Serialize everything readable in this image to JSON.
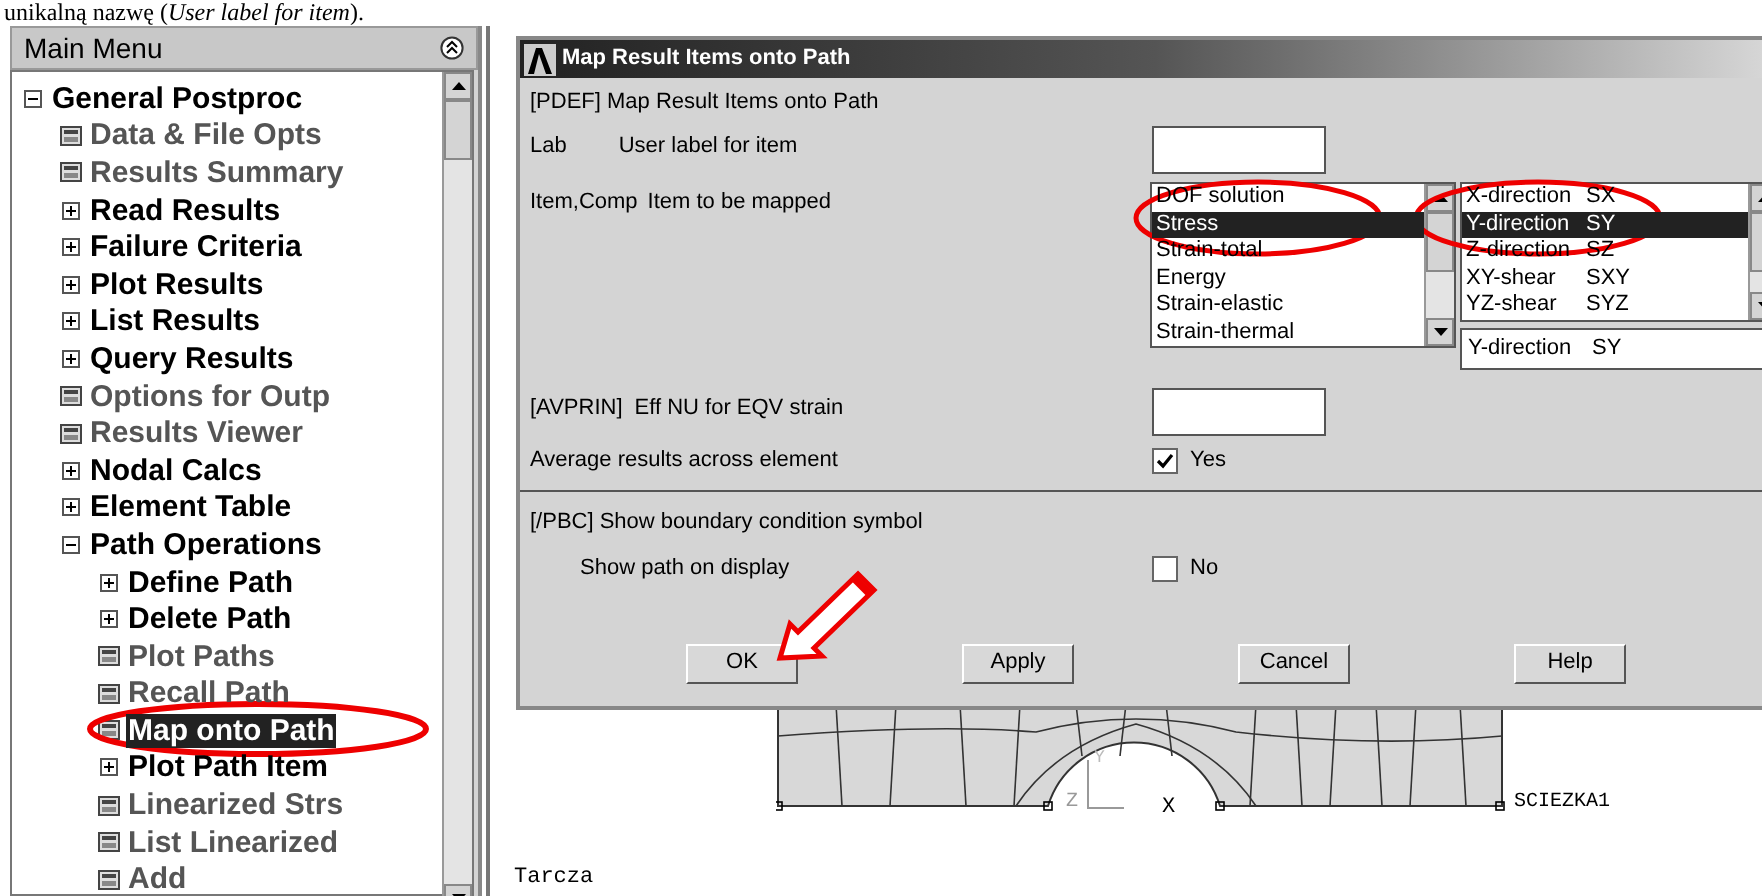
{
  "caption": "unikalną nazwę (*User label for item*).",
  "main_menu": {
    "title": "Main Menu",
    "tree": [
      {
        "label": "General Postproc",
        "kind": "folder",
        "expanded": true,
        "disabled": false,
        "selected": false,
        "children": [
          {
            "label": "Data & File Opts",
            "kind": "command",
            "disabled": true,
            "selected": false
          },
          {
            "label": "Results Summary",
            "kind": "command",
            "disabled": true,
            "selected": false
          },
          {
            "label": "Read Results",
            "kind": "folder",
            "expanded": false,
            "disabled": false,
            "selected": false
          },
          {
            "label": "Failure Criteria",
            "kind": "folder",
            "expanded": false,
            "disabled": false,
            "selected": false
          },
          {
            "label": "Plot Results",
            "kind": "folder",
            "expanded": false,
            "disabled": false,
            "selected": false
          },
          {
            "label": "List Results",
            "kind": "folder",
            "expanded": false,
            "disabled": false,
            "selected": false
          },
          {
            "label": "Query Results",
            "kind": "folder",
            "expanded": false,
            "disabled": false,
            "selected": false
          },
          {
            "label": "Options for Outp",
            "kind": "command",
            "disabled": true,
            "selected": false
          },
          {
            "label": "Results Viewer",
            "kind": "command",
            "disabled": true,
            "selected": false
          },
          {
            "label": "Nodal Calcs",
            "kind": "folder",
            "expanded": false,
            "disabled": false,
            "selected": false
          },
          {
            "label": "Element Table",
            "kind": "folder",
            "expanded": false,
            "disabled": false,
            "selected": false
          },
          {
            "label": "Path Operations",
            "kind": "folder",
            "expanded": true,
            "disabled": false,
            "selected": false,
            "children": [
              {
                "label": "Define Path",
                "kind": "folder",
                "expanded": false,
                "disabled": false,
                "selected": false
              },
              {
                "label": "Delete Path",
                "kind": "folder",
                "expanded": false,
                "disabled": false,
                "selected": false
              },
              {
                "label": "Plot Paths",
                "kind": "command",
                "disabled": true,
                "selected": false
              },
              {
                "label": "Recall Path",
                "kind": "command",
                "disabled": true,
                "selected": false
              },
              {
                "label": "Map onto Path",
                "kind": "command",
                "disabled": false,
                "selected": true
              },
              {
                "label": "Plot Path Item",
                "kind": "folder",
                "expanded": false,
                "disabled": false,
                "selected": false
              },
              {
                "label": "Linearized Strs",
                "kind": "command",
                "disabled": true,
                "selected": false
              },
              {
                "label": "List Linearized",
                "kind": "command",
                "disabled": true,
                "selected": false
              },
              {
                "label": "Add",
                "kind": "command",
                "disabled": true,
                "selected": false
              }
            ]
          }
        ]
      }
    ]
  },
  "dialog": {
    "title": "Map Result Items onto Path",
    "heading": "[PDEF]  Map Result Items onto Path",
    "lab": {
      "label": "Lab",
      "description": "User label for item"
    },
    "item_comp": {
      "label": "Item,Comp",
      "description": "Item to be mapped",
      "items": [
        {
          "label": "DOF solution",
          "selected": false
        },
        {
          "label": "Stress",
          "selected": true
        },
        {
          "label": "Strain-total",
          "selected": false
        },
        {
          "label": "Energy",
          "selected": false
        },
        {
          "label": "Strain-elastic",
          "selected": false
        },
        {
          "label": "Strain-thermal",
          "selected": false
        }
      ],
      "components": [
        {
          "name": "X-direction",
          "code": "SX",
          "selected": false
        },
        {
          "name": "Y-direction",
          "code": "SY",
          "selected": true
        },
        {
          "name": "Z-direction",
          "code": "SZ",
          "selected": false
        },
        {
          "name": "XY-shear",
          "code": "SXY",
          "selected": false
        },
        {
          "name": "YZ-shear",
          "code": "SYZ",
          "selected": false
        }
      ],
      "component_value": {
        "name": "Y-direction",
        "code": "SY"
      }
    },
    "avprin": {
      "label": "[AVPRIN]",
      "description": "Eff NU for EQV strain"
    },
    "average": {
      "label": "Average results across element",
      "checked": true,
      "value_label": "Yes"
    },
    "pbc": {
      "heading": "[/PBC]  Show boundary condition symbol",
      "label": "Show path on display",
      "checked": false,
      "value_label": "No"
    },
    "buttons": [
      "OK",
      "Apply",
      "Cancel",
      "Help"
    ]
  },
  "graphics": {
    "axis_labels": [
      "Y",
      "Z",
      "X"
    ],
    "path_label": "SCIEZKA1",
    "title": "Tarcza"
  }
}
